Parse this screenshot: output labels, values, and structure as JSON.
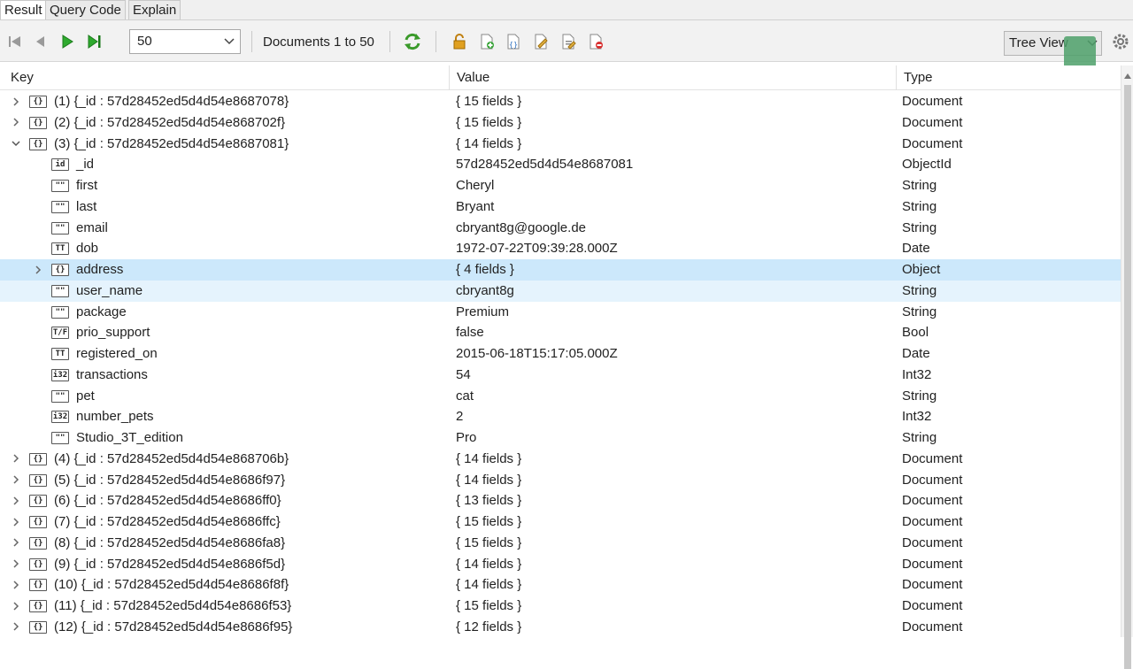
{
  "tabs": [
    "Result",
    "Query Code",
    "Explain"
  ],
  "toolbar": {
    "page_size": "50",
    "documents_range": "Documents 1 to 50",
    "view_mode": "Tree View"
  },
  "columns": {
    "key": "Key",
    "value": "Value",
    "type": "Type"
  },
  "rows": [
    {
      "level": 0,
      "expander": "collapsed",
      "icon": "document-icon",
      "glyph": "{}",
      "key": "(1) {_id : 57d28452ed5d4d54e8687078}",
      "value": "{ 15 fields }",
      "type": "Document"
    },
    {
      "level": 0,
      "expander": "collapsed",
      "icon": "document-icon",
      "glyph": "{}",
      "key": "(2) {_id : 57d28452ed5d4d54e868702f}",
      "value": "{ 15 fields }",
      "type": "Document"
    },
    {
      "level": 0,
      "expander": "expanded",
      "icon": "document-icon",
      "glyph": "{}",
      "key": "(3) {_id : 57d28452ed5d4d54e8687081}",
      "value": "{ 14 fields }",
      "type": "Document"
    },
    {
      "level": 1,
      "expander": "none",
      "icon": "objectid-icon",
      "glyph": "id",
      "key": "_id",
      "value": "57d28452ed5d4d54e8687081",
      "type": "ObjectId"
    },
    {
      "level": 1,
      "expander": "none",
      "icon": "string-icon",
      "glyph": "\"\"",
      "key": "first",
      "value": "Cheryl",
      "type": "String"
    },
    {
      "level": 1,
      "expander": "none",
      "icon": "string-icon",
      "glyph": "\"\"",
      "key": "last",
      "value": "Bryant",
      "type": "String"
    },
    {
      "level": 1,
      "expander": "none",
      "icon": "string-icon",
      "glyph": "\"\"",
      "key": "email",
      "value": "cbryant8g@google.de",
      "type": "String"
    },
    {
      "level": 1,
      "expander": "none",
      "icon": "date-icon",
      "glyph": "TT",
      "key": "dob",
      "value": "1972-07-22T09:39:28.000Z",
      "type": "Date"
    },
    {
      "level": 1,
      "expander": "collapsed",
      "icon": "object-icon",
      "glyph": "{}",
      "key": "address",
      "value": "{ 4 fields }",
      "type": "Object",
      "state": "selected"
    },
    {
      "level": 1,
      "expander": "none",
      "icon": "string-icon",
      "glyph": "\"\"",
      "key": "user_name",
      "value": "cbryant8g",
      "type": "String",
      "state": "hover"
    },
    {
      "level": 1,
      "expander": "none",
      "icon": "string-icon",
      "glyph": "\"\"",
      "key": "package",
      "value": "Premium",
      "type": "String"
    },
    {
      "level": 1,
      "expander": "none",
      "icon": "bool-icon",
      "glyph": "T/F",
      "key": "prio_support",
      "value": "false",
      "type": "Bool"
    },
    {
      "level": 1,
      "expander": "none",
      "icon": "date-icon",
      "glyph": "TT",
      "key": "registered_on",
      "value": "2015-06-18T15:17:05.000Z",
      "type": "Date"
    },
    {
      "level": 1,
      "expander": "none",
      "icon": "int32-icon",
      "glyph": "i32",
      "key": "transactions",
      "value": "54",
      "type": "Int32"
    },
    {
      "level": 1,
      "expander": "none",
      "icon": "string-icon",
      "glyph": "\"\"",
      "key": "pet",
      "value": "cat",
      "type": "String"
    },
    {
      "level": 1,
      "expander": "none",
      "icon": "int32-icon",
      "glyph": "i32",
      "key": "number_pets",
      "value": "2",
      "type": "Int32"
    },
    {
      "level": 1,
      "expander": "none",
      "icon": "string-icon",
      "glyph": "\"\"",
      "key": "Studio_3T_edition",
      "value": "Pro",
      "type": "String"
    },
    {
      "level": 0,
      "expander": "collapsed",
      "icon": "document-icon",
      "glyph": "{}",
      "key": "(4) {_id : 57d28452ed5d4d54e868706b}",
      "value": "{ 14 fields }",
      "type": "Document"
    },
    {
      "level": 0,
      "expander": "collapsed",
      "icon": "document-icon",
      "glyph": "{}",
      "key": "(5) {_id : 57d28452ed5d4d54e8686f97}",
      "value": "{ 14 fields }",
      "type": "Document"
    },
    {
      "level": 0,
      "expander": "collapsed",
      "icon": "document-icon",
      "glyph": "{}",
      "key": "(6) {_id : 57d28452ed5d4d54e8686ff0}",
      "value": "{ 13 fields }",
      "type": "Document"
    },
    {
      "level": 0,
      "expander": "collapsed",
      "icon": "document-icon",
      "glyph": "{}",
      "key": "(7) {_id : 57d28452ed5d4d54e8686ffc}",
      "value": "{ 15 fields }",
      "type": "Document"
    },
    {
      "level": 0,
      "expander": "collapsed",
      "icon": "document-icon",
      "glyph": "{}",
      "key": "(8) {_id : 57d28452ed5d4d54e8686fa8}",
      "value": "{ 15 fields }",
      "type": "Document"
    },
    {
      "level": 0,
      "expander": "collapsed",
      "icon": "document-icon",
      "glyph": "{}",
      "key": "(9) {_id : 57d28452ed5d4d54e8686f5d}",
      "value": "{ 14 fields }",
      "type": "Document"
    },
    {
      "level": 0,
      "expander": "collapsed",
      "icon": "document-icon",
      "glyph": "{}",
      "key": "(10) {_id : 57d28452ed5d4d54e8686f8f}",
      "value": "{ 14 fields }",
      "type": "Document"
    },
    {
      "level": 0,
      "expander": "collapsed",
      "icon": "document-icon",
      "glyph": "{}",
      "key": "(11) {_id : 57d28452ed5d4d54e8686f53}",
      "value": "{ 15 fields }",
      "type": "Document"
    },
    {
      "level": 0,
      "expander": "collapsed",
      "icon": "document-icon",
      "glyph": "{}",
      "key": "(12) {_id : 57d28452ed5d4d54e8686f95}",
      "value": "{ 12 fields }",
      "type": "Document"
    }
  ],
  "colors": {
    "selected_row": "#cce8fb",
    "hover_row": "#e5f3fd",
    "play_green": "#2eaa2e",
    "refresh_green": "#3a9a2a",
    "lock_orange": "#e0a020"
  }
}
